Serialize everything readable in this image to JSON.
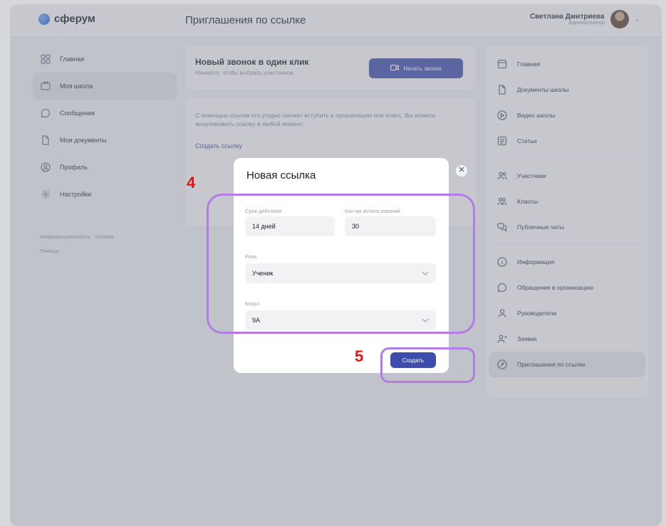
{
  "header": {
    "logo_text": "сферум",
    "page_title": "Приглашения по ссылке",
    "user_name": "Светлана Дмитриева",
    "user_role": "Администратор"
  },
  "left_nav": {
    "items": [
      {
        "label": "Главная",
        "icon": "grid-icon"
      },
      {
        "label": "Моя школа",
        "icon": "school-icon",
        "active": true
      },
      {
        "label": "Сообщения",
        "icon": "chat-icon"
      },
      {
        "label": "Мои документы",
        "icon": "document-icon"
      },
      {
        "label": "Профиль",
        "icon": "profile-icon"
      },
      {
        "label": "Настройки",
        "icon": "gear-icon"
      }
    ],
    "footer_links": [
      "Конфиденциальность",
      "Условия",
      "Помощь"
    ]
  },
  "call_card": {
    "title": "Новый звонок в один клик",
    "subtitle": "Нажмите, чтобы выбрать участников",
    "button_label": "Начать звонок"
  },
  "info_card": {
    "text": "С помощью ссылки кто угодно сможет вступить в организацию или класс. Вы можете аннулировать ссылку в любой момент.",
    "link_label": "Создать ссылку"
  },
  "right_nav": {
    "group1": [
      {
        "label": "Главная",
        "icon": "home-icon"
      },
      {
        "label": "Документы школы",
        "icon": "document-icon"
      },
      {
        "label": "Видео школы",
        "icon": "play-icon"
      },
      {
        "label": "Статьи",
        "icon": "article-icon"
      }
    ],
    "group2": [
      {
        "label": "Участники",
        "icon": "users-icon"
      },
      {
        "label": "Классы",
        "icon": "classes-icon"
      },
      {
        "label": "Публичные чаты",
        "icon": "chats-icon"
      }
    ],
    "group3": [
      {
        "label": "Информация",
        "icon": "info-icon"
      },
      {
        "label": "Обращения в организацию",
        "icon": "chat-icon"
      },
      {
        "label": "Руководители",
        "icon": "person-icon"
      },
      {
        "label": "Заявки",
        "icon": "add-person-icon"
      },
      {
        "label": "Приглашения по ссылке",
        "icon": "link-icon",
        "active": true
      }
    ]
  },
  "modal": {
    "title": "Новая ссылка",
    "validity_label": "Срок действия",
    "validity_value": "14 дней",
    "uses_label": "Кол-во использований",
    "uses_value": "30",
    "role_label": "Роль",
    "role_value": "Ученик",
    "class_label": "Класс",
    "class_value": "9А",
    "create_label": "Создать"
  },
  "annotations": {
    "step4": "4",
    "step5": "5",
    "highlight_color": "#b27be6",
    "number_color": "#e41313"
  },
  "colors": {
    "accent": "#3d4cad"
  }
}
